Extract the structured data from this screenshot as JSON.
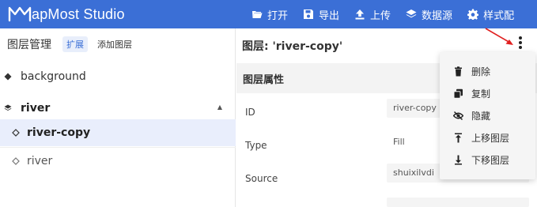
{
  "app": {
    "logo_text": "apMost Studio",
    "accent_color": "#3b6fd6"
  },
  "toolbar": {
    "items": [
      {
        "label": "打开",
        "icon": "folder-open-icon"
      },
      {
        "label": "导出",
        "icon": "save-icon"
      },
      {
        "label": "上传",
        "icon": "upload-icon"
      },
      {
        "label": "数据源",
        "icon": "layers-icon"
      },
      {
        "label": "样式配",
        "icon": "gear-icon"
      }
    ]
  },
  "left_panel": {
    "title": "图层管理",
    "expand_label": "扩展",
    "add_layer_label": "添加图层",
    "layers": [
      {
        "name": "background",
        "type": "diamond-icon",
        "selected": false
      },
      {
        "name": "river",
        "type": "layers-icon",
        "group": true
      },
      {
        "name": "river-copy",
        "type": "diamond-outline-icon",
        "selected": true
      },
      {
        "name": "river",
        "type": "diamond-outline-icon",
        "selected": false
      }
    ]
  },
  "right_panel": {
    "title": "图层: 'river-copy'",
    "section_title": "图层属性",
    "props": [
      {
        "label": "ID",
        "value": "river-copy"
      },
      {
        "label": "Type",
        "value": "Fill"
      },
      {
        "label": "Source",
        "value": "shuixilvdi"
      }
    ]
  },
  "context_menu": {
    "items": [
      {
        "label": "删除",
        "icon": "trash-icon"
      },
      {
        "label": "复制",
        "icon": "copy-icon"
      },
      {
        "label": "隐藏",
        "icon": "eye-off-icon"
      },
      {
        "label": "上移图层",
        "icon": "arrow-up-icon"
      },
      {
        "label": "下移图层",
        "icon": "arrow-down-icon"
      }
    ]
  }
}
